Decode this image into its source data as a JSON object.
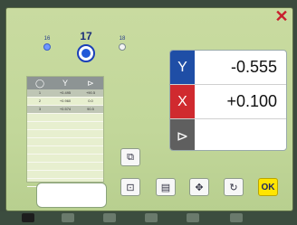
{
  "window": {
    "close_glyph": "✕"
  },
  "modes": [
    {
      "label": "16",
      "active": false
    },
    {
      "label": "17",
      "active": true
    },
    {
      "label": "18",
      "active": false
    }
  ],
  "table": {
    "headers": [
      "◯",
      "Y",
      "⊳"
    ],
    "rows": [
      [
        "1",
        "+0.495",
        "+90.5"
      ],
      [
        "2",
        "+0.960",
        "0.0"
      ],
      [
        "3",
        "+0.574",
        "90.5"
      ],
      [
        "",
        "",
        ""
      ],
      [
        "",
        "",
        ""
      ],
      [
        "",
        "",
        ""
      ],
      [
        "",
        "",
        ""
      ],
      [
        "",
        "",
        ""
      ],
      [
        "",
        "",
        ""
      ],
      [
        "",
        "",
        ""
      ],
      [
        "",
        "",
        ""
      ],
      [
        "",
        "",
        ""
      ]
    ]
  },
  "readout": {
    "y_label": "Y",
    "y_value": "-0.555",
    "x_label": "X",
    "x_value": "+0.100",
    "angle_label": "⊳",
    "angle_value": ""
  },
  "input": {
    "value": ""
  },
  "buttons": {
    "copy": "⧉",
    "center": "⊡",
    "calc": "▤",
    "move": "✥",
    "rotate": "↻",
    "ok": "OK"
  },
  "taskbar": {
    "items": [
      "app-icon",
      "chart-icon",
      "print-icon",
      "folder-icon",
      "network-icon",
      "menu-icon"
    ]
  }
}
